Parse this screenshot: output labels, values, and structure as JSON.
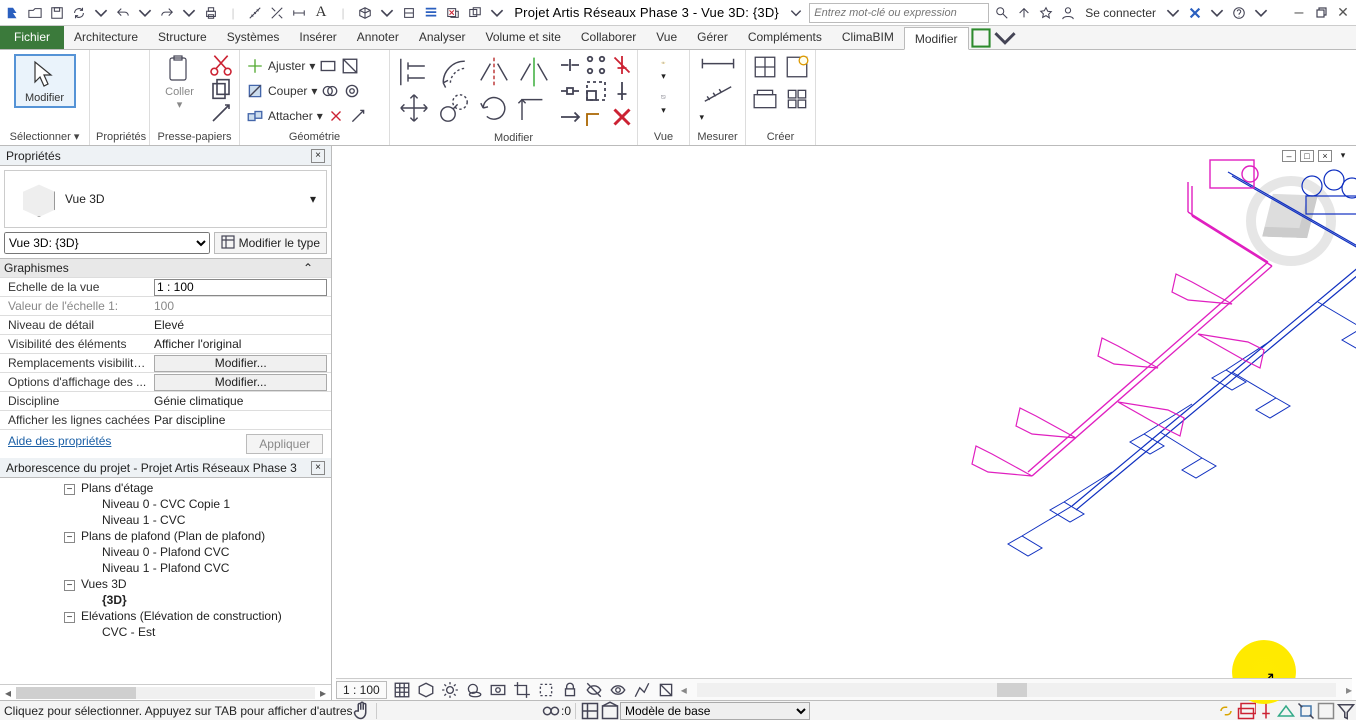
{
  "title": "Projet Artis Réseaux Phase 3 - Vue 3D: {3D}",
  "search_placeholder": "Entrez mot-clé ou expression",
  "sign_in": "Se connecter",
  "tabs": {
    "file": "Fichier",
    "items": [
      "Architecture",
      "Structure",
      "Systèmes",
      "Insérer",
      "Annoter",
      "Analyser",
      "Volume et site",
      "Collaborer",
      "Vue",
      "Gérer",
      "Compléments",
      "ClimaBIM",
      "Modifier"
    ],
    "active": "Modifier"
  },
  "ribbon": {
    "select": {
      "label": "Sélectionner",
      "modify": "Modifier"
    },
    "properties": {
      "label": "Propriétés"
    },
    "clipboard": {
      "label": "Presse-papiers",
      "paste": "Coller"
    },
    "geometry": {
      "label": "Géométrie",
      "ajuster": "Ajuster",
      "couper": "Couper",
      "attacher": "Attacher"
    },
    "modify": {
      "label": "Modifier"
    },
    "view": {
      "label": "Vue"
    },
    "measure": {
      "label": "Mesurer"
    },
    "create": {
      "label": "Créer"
    }
  },
  "properties": {
    "title": "Propriétés",
    "type_name": "Vue 3D",
    "instance_sel": "Vue 3D: {3D}",
    "mod_type": "Modifier le type",
    "group": "Graphismes",
    "rows": {
      "echelle_k": "Echelle de la vue",
      "echelle_v": "1 : 100",
      "valeur_k": "Valeur de l'échelle    1:",
      "valeur_v": "100",
      "detail_k": "Niveau de détail",
      "detail_v": "Elevé",
      "visib_k": "Visibilité des éléments",
      "visib_v": "Afficher l'original",
      "repl_k": "Remplacements visibilité...",
      "repl_v": "Modifier...",
      "opts_k": "Options d'affichage des ...",
      "opts_v": "Modifier...",
      "disc_k": "Discipline",
      "disc_v": "Génie climatique",
      "hidden_k": "Afficher les lignes cachées",
      "hidden_v": "Par discipline"
    },
    "help": "Aide des propriétés",
    "apply": "Appliquer"
  },
  "browser": {
    "title": "Arborescence du projet - Projet Artis Réseaux Phase 3",
    "plans_etage": "Plans d'étage",
    "plans_etage_children": [
      "Niveau 0 - CVC Copie 1",
      "Niveau 1 - CVC"
    ],
    "plans_plafond": "Plans de plafond (Plan de plafond)",
    "plans_plafond_children": [
      "Niveau 0 - Plafond CVC",
      "Niveau 1 - Plafond CVC"
    ],
    "vues3d": "Vues 3D",
    "vues3d_children": [
      "{3D}"
    ],
    "elevations": "Elévations (Elévation de construction)",
    "elevations_children": [
      "CVC - Est"
    ]
  },
  "viewbar": {
    "scale": "1 : 100"
  },
  "status": {
    "msg": "Cliquez pour sélectionner. Appuyez sur TAB pour afficher d'autres",
    "zero": ":0",
    "model": "Modèle de base"
  }
}
